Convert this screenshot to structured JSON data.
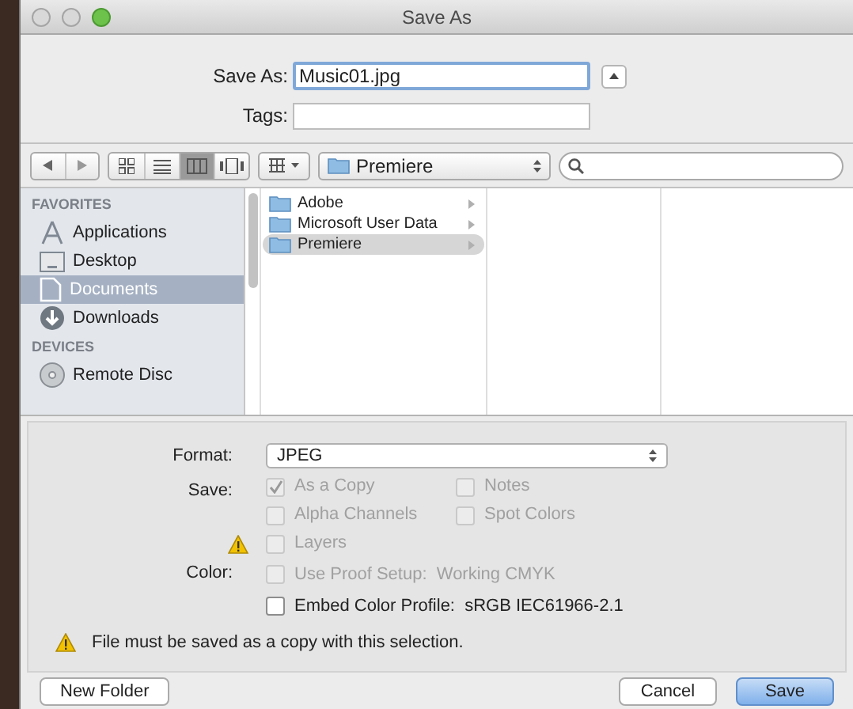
{
  "window": {
    "title": "Save As"
  },
  "save_as": {
    "label": "Save As:",
    "value": "Music01.jpg"
  },
  "tags": {
    "label": "Tags:"
  },
  "toolbar": {
    "view_modes": [
      {
        "kind": "icons",
        "selected": false
      },
      {
        "kind": "list",
        "selected": false
      },
      {
        "kind": "columns",
        "selected": true
      },
      {
        "kind": "coverflow",
        "selected": false
      }
    ],
    "location": "Premiere"
  },
  "sidebar": [
    {
      "heading": "FAVORITES",
      "items": [
        {
          "kind": "applications",
          "label": "Applications",
          "selected": false
        },
        {
          "kind": "desktop",
          "label": "Desktop",
          "selected": false
        },
        {
          "kind": "documents",
          "label": "Documents",
          "selected": true
        },
        {
          "kind": "downloads",
          "label": "Downloads",
          "selected": false
        }
      ]
    },
    {
      "heading": "DEVICES",
      "items": [
        {
          "kind": "disc",
          "label": "Remote Disc",
          "selected": false
        }
      ]
    }
  ],
  "column_1": [
    {
      "name": "Adobe",
      "selected": false
    },
    {
      "name": "Microsoft User Data",
      "selected": false
    },
    {
      "name": "Premiere",
      "selected": true
    }
  ],
  "options": {
    "format": {
      "label": "Format:",
      "value": "JPEG"
    },
    "save_label": "Save:",
    "save": [
      {
        "label": "As a Copy",
        "checked": true,
        "disabled": true,
        "warning": false
      },
      {
        "label": "Notes",
        "checked": false,
        "disabled": true,
        "warning": false
      },
      {
        "label": "Alpha Channels",
        "checked": false,
        "disabled": true,
        "warning": false
      },
      {
        "label": "Spot Colors",
        "checked": false,
        "disabled": true,
        "warning": false
      },
      {
        "label": "Layers",
        "checked": false,
        "disabled": true,
        "warning": true
      }
    ],
    "color_label": "Color:",
    "color": [
      {
        "label": "Use Proof Setup:  Working CMYK",
        "checked": false,
        "disabled": true
      },
      {
        "label": "Embed Color Profile:  sRGB IEC61966-2.1",
        "checked": false,
        "disabled": false
      }
    ],
    "message": "File must be saved as a copy with this selection."
  },
  "buttons": {
    "new_folder": "New Folder",
    "cancel": "Cancel",
    "save": "Save"
  }
}
